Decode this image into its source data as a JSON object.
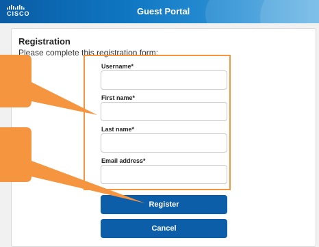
{
  "header": {
    "logo_text": "CISCO",
    "title": "Guest Portal",
    "logo_icon": "cisco-bars-logo"
  },
  "registration": {
    "title": "Registration",
    "subtitle": "Please complete this registration form:"
  },
  "form": {
    "fields": [
      {
        "label": "Username*",
        "value": ""
      },
      {
        "label": "First name*",
        "value": ""
      },
      {
        "label": "Last name*",
        "value": ""
      },
      {
        "label": "Email address*",
        "value": ""
      }
    ],
    "register_label": "Register",
    "cancel_label": "Cancel"
  },
  "colors": {
    "header_blue": "#0f76c2",
    "button_blue": "#0d5ea8",
    "callout_orange": "#f5953f"
  }
}
